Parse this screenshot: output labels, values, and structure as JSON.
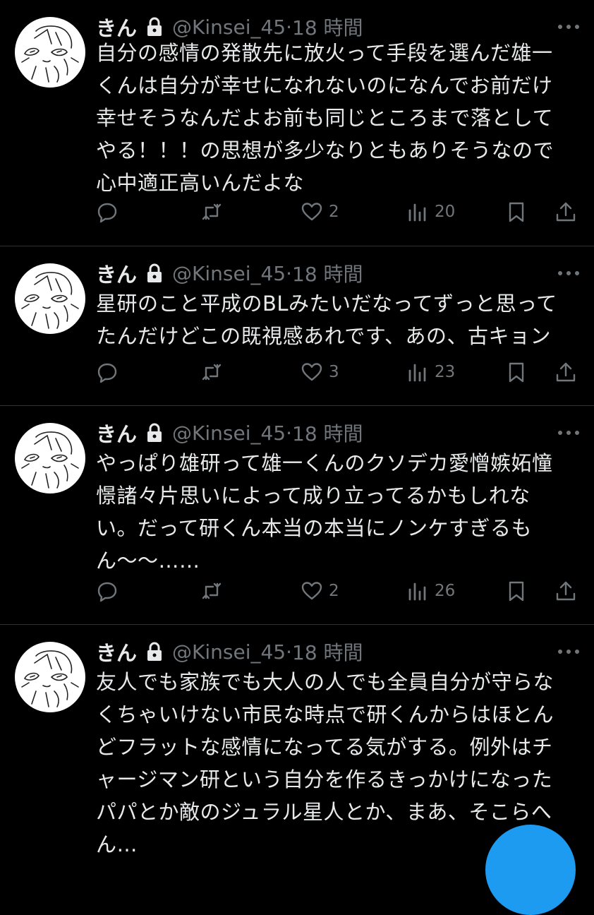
{
  "tweets": [
    {
      "name": "きん",
      "handle": "@Kinsei_45",
      "time": "18 時間",
      "text": "自分の感情の発散先に放火って手段を選んだ雄一\nくんは自分が幸せになれないのになんでお前だけ\n幸せそうなんだよお前も同じところまで落として\nやる！！！の思想が多少なりともありそうなので\n心中適正高いんだよな",
      "likes": "2",
      "views": "20"
    },
    {
      "name": "きん",
      "handle": "@Kinsei_45",
      "time": "18 時間",
      "text": "星研のこと平成のBLみたいだなってずっと思って\nたんだけどこの既視感あれです、あの、古キョン",
      "likes": "3",
      "views": "23"
    },
    {
      "name": "きん",
      "handle": "@Kinsei_45",
      "time": "18 時間",
      "text": "やっぱり雄研って雄一くんのクソデカ愛憎嫉妬憧\n憬諸々片思いによって成り立ってるかもしれな\nい。だって研くん本当の本当にノンケすぎるも\nん〜〜……",
      "likes": "2",
      "views": "26"
    },
    {
      "name": "きん",
      "handle": "@Kinsei_45",
      "time": "18 時間",
      "text": "友人でも家族でも大人の人でも全員自分が守らな\nくちゃいけない市民な時点で研くんからはほとん\nどフラットな感情になってる気がする。例外はチ\nャージマン研という自分を作るきっかけになった\nパパとか敵のジュラル星人とか、まあ、そこらへ\nん…",
      "likes": "",
      "views": ""
    }
  ],
  "icons": {
    "reply": "reply-icon",
    "retweet": "retweet-icon",
    "like": "heart-icon",
    "views": "views-icon",
    "bookmark": "bookmark-icon",
    "share": "share-icon",
    "more": "more-icon",
    "lock": "lock-icon"
  },
  "colors": {
    "background": "#000000",
    "text": "#e7e9ea",
    "muted": "#71767b",
    "separator": "#2f3336",
    "accent": "#1d9bf0"
  }
}
